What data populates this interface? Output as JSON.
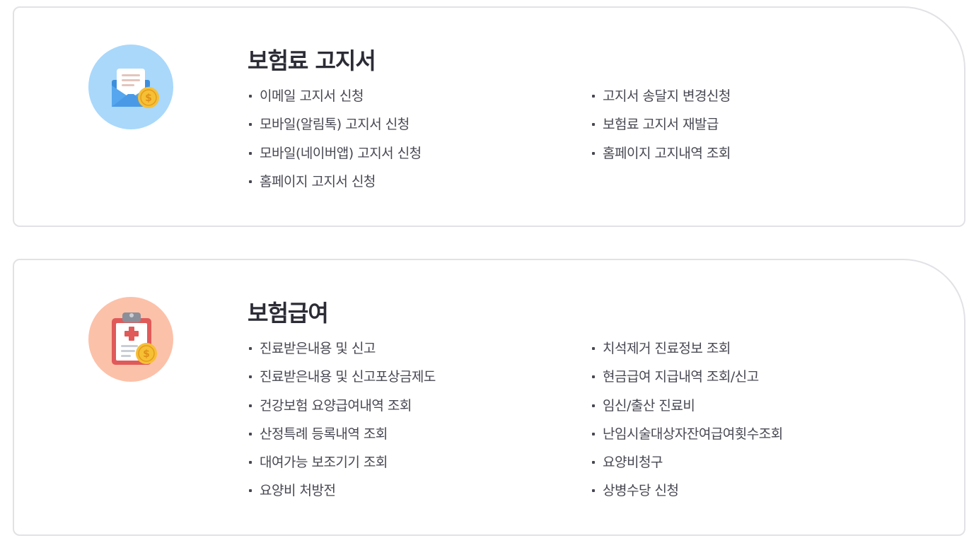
{
  "notice": {
    "title": "보험료 고지서",
    "left_links": [
      "이메일 고지서 신청",
      "모바일(알림톡) 고지서 신청",
      "모바일(네이버앱) 고지서 신청",
      "홈페이지 고지서 신청"
    ],
    "right_links": [
      "고지서 송달지 변경신청",
      "보험료 고지서 재발급",
      "홈페이지 고지내역 조회"
    ],
    "icon": "envelope-coin-icon",
    "icon_bg": "#a9d8fb"
  },
  "benefit": {
    "title": "보험급여",
    "left_links": [
      "진료받은내용 및 신고",
      "진료받은내용 및 신고포상금제도",
      "건강보험 요양급여내역 조회",
      "산정특례 등록내역 조회",
      "대여가능 보조기기 조회",
      "요양비 처방전"
    ],
    "right_links": [
      "치석제거 진료정보 조회",
      "현금급여 지급내역 조회/신고",
      "임신/출산 진료비",
      "난임시술대상자잔여급여횟수조회",
      "요양비청구",
      "상병수당 신청"
    ],
    "icon": "medical-clipboard-coin-icon",
    "icon_bg": "#fcc1a9"
  },
  "colors": {
    "card_border": "#e2e2e6",
    "title_text": "#2c2c36",
    "link_text": "#474752",
    "coin": "#f6c034"
  }
}
